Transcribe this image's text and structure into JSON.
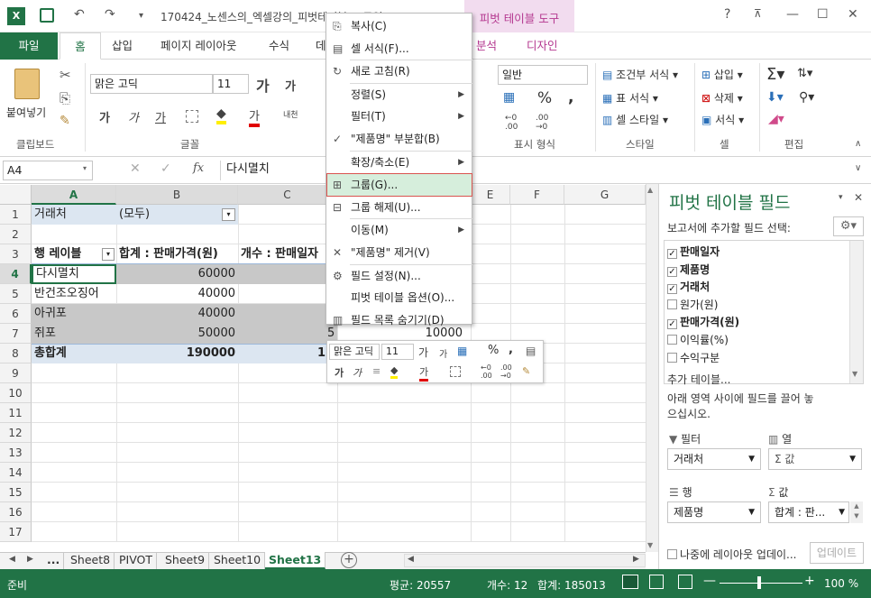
{
  "title_bar": {
    "title": "170424_노센스의_엑셀강의_피벗테이블_드로잉 - Ex...",
    "context_tab": "피벗 테이블 도구",
    "help": "?",
    "min": "—",
    "max": "☐",
    "close": "✕"
  },
  "ribbon_tabs": [
    "파일",
    "홈",
    "삽입",
    "페이지 레이아웃",
    "수식",
    "데",
    "분석",
    "디자인"
  ],
  "ribbon": {
    "clipboard": {
      "paste": "붙여넣기",
      "label": "클립보드"
    },
    "font": {
      "name": "맑은 고딕",
      "size": "11",
      "label": "글꼴"
    },
    "number": {
      "format": "일반",
      "label": "표시 형식"
    },
    "styles": {
      "cond": "조건부 서식",
      "table": "표 서식",
      "cell": "셀 스타일",
      "label": "스타일"
    },
    "cells": {
      "insert": "삽입",
      "delete": "삭제",
      "format": "서식",
      "label": "셀"
    },
    "edit": {
      "label": "편집"
    }
  },
  "formula_bar": {
    "namebox": "A4",
    "fx": "fx",
    "content": "다시멸치"
  },
  "columns": [
    "A",
    "B",
    "C",
    "D",
    "E",
    "F",
    "G"
  ],
  "rows": [
    "1",
    "2",
    "3",
    "4",
    "5",
    "6",
    "7",
    "8",
    "9",
    "10",
    "11",
    "12",
    "13",
    "14",
    "15",
    "16",
    "17"
  ],
  "pivot": {
    "filter_label": "거래처",
    "filter_value": "(모두)",
    "row_label_hdr": "행 레이블",
    "sum_hdr": "합계 : 판매가격(원)",
    "count_hdr": "개수 : 판매일자",
    "rows": [
      {
        "label": "다시멸치",
        "sum": "60000",
        "count": ""
      },
      {
        "label": "반건조오징어",
        "sum": "40000",
        "count": ""
      },
      {
        "label": "아귀포",
        "sum": "40000",
        "count": ""
      },
      {
        "label": "쥐포",
        "sum": "50000",
        "count": "5"
      },
      {
        "label": "총합계",
        "sum": "190000",
        "count": "1"
      }
    ],
    "extra_g7": "10000"
  },
  "context_menu": [
    {
      "icon": "copy-icon",
      "glyph": "⎘",
      "label": "복사(C)"
    },
    {
      "icon": "format-cells-icon",
      "glyph": "▤",
      "label": "셀 서식(F)..."
    },
    {
      "sep": true
    },
    {
      "icon": "refresh-icon",
      "glyph": "↻",
      "label": "새로 고침(R)"
    },
    {
      "sep": true
    },
    {
      "icon": "",
      "glyph": "",
      "label": "정렬(S)",
      "arrow": true
    },
    {
      "icon": "",
      "glyph": "",
      "label": "필터(T)",
      "arrow": true
    },
    {
      "icon": "check-icon",
      "glyph": "✓",
      "label": "\"제품명\" 부분합(B)"
    },
    {
      "sep": true
    },
    {
      "icon": "",
      "glyph": "",
      "label": "확장/축소(E)",
      "arrow": true
    },
    {
      "sep": true
    },
    {
      "icon": "group-icon",
      "glyph": "⊞",
      "label": "그룹(G)...",
      "highlight": true
    },
    {
      "icon": "ungroup-icon",
      "glyph": "⊟",
      "label": "그룹 해제(U)..."
    },
    {
      "sep": true
    },
    {
      "icon": "",
      "glyph": "",
      "label": "이동(M)",
      "arrow": true
    },
    {
      "icon": "remove-icon",
      "glyph": "✕",
      "label": "\"제품명\" 제거(V)"
    },
    {
      "sep": true
    },
    {
      "icon": "field-settings-icon",
      "glyph": "⚙",
      "label": "필드 설정(N)..."
    },
    {
      "icon": "",
      "glyph": "",
      "label": "피벗 테이블 옵션(O)..."
    },
    {
      "icon": "field-list-icon",
      "glyph": "▥",
      "label": "필드 목록 숨기기(D)"
    }
  ],
  "mini_toolbar": {
    "font": "맑은 고딕",
    "size": "11"
  },
  "pane": {
    "title": "피벗 테이블 필드",
    "subtitle": "보고서에 추가할 필드 선택:",
    "fields": [
      {
        "label": "판매일자",
        "checked": true
      },
      {
        "label": "제품명",
        "checked": true
      },
      {
        "label": "거래처",
        "checked": true
      },
      {
        "label": "원가(원)",
        "checked": false
      },
      {
        "label": "판매가격(원)",
        "checked": true
      },
      {
        "label": "이익률(%)",
        "checked": false
      },
      {
        "label": "수익구분",
        "checked": false
      }
    ],
    "more": "추가 테이블...",
    "drag_hint": "아래 영역 사이에 필드를 끌어 놓으십시오.",
    "area_filter": "필터",
    "area_cols": "열",
    "area_rows": "행",
    "area_values": "값",
    "filter_item": "거래처",
    "cols_item": "Σ 값",
    "rows_item": "제품명",
    "values_item": "합계 : 판...",
    "defer": "나중에 레이아웃 업데이...",
    "update": "업데이트"
  },
  "sheet_tabs": [
    "...",
    "Sheet8",
    "PIVOT",
    "Sheet9",
    "Sheet10",
    "Sheet13"
  ],
  "status": {
    "ready": "준비",
    "avg": "평균: 20557",
    "count": "개수: 12",
    "sum": "합계: 185013",
    "zoom": "100 %"
  },
  "colors": {
    "excel_green": "#217346",
    "pivot_blue": "#dce6f1",
    "context_pink": "#b4378f",
    "menu_highlight": "#d6eedc",
    "selection_gray": "#c0c0c0"
  }
}
